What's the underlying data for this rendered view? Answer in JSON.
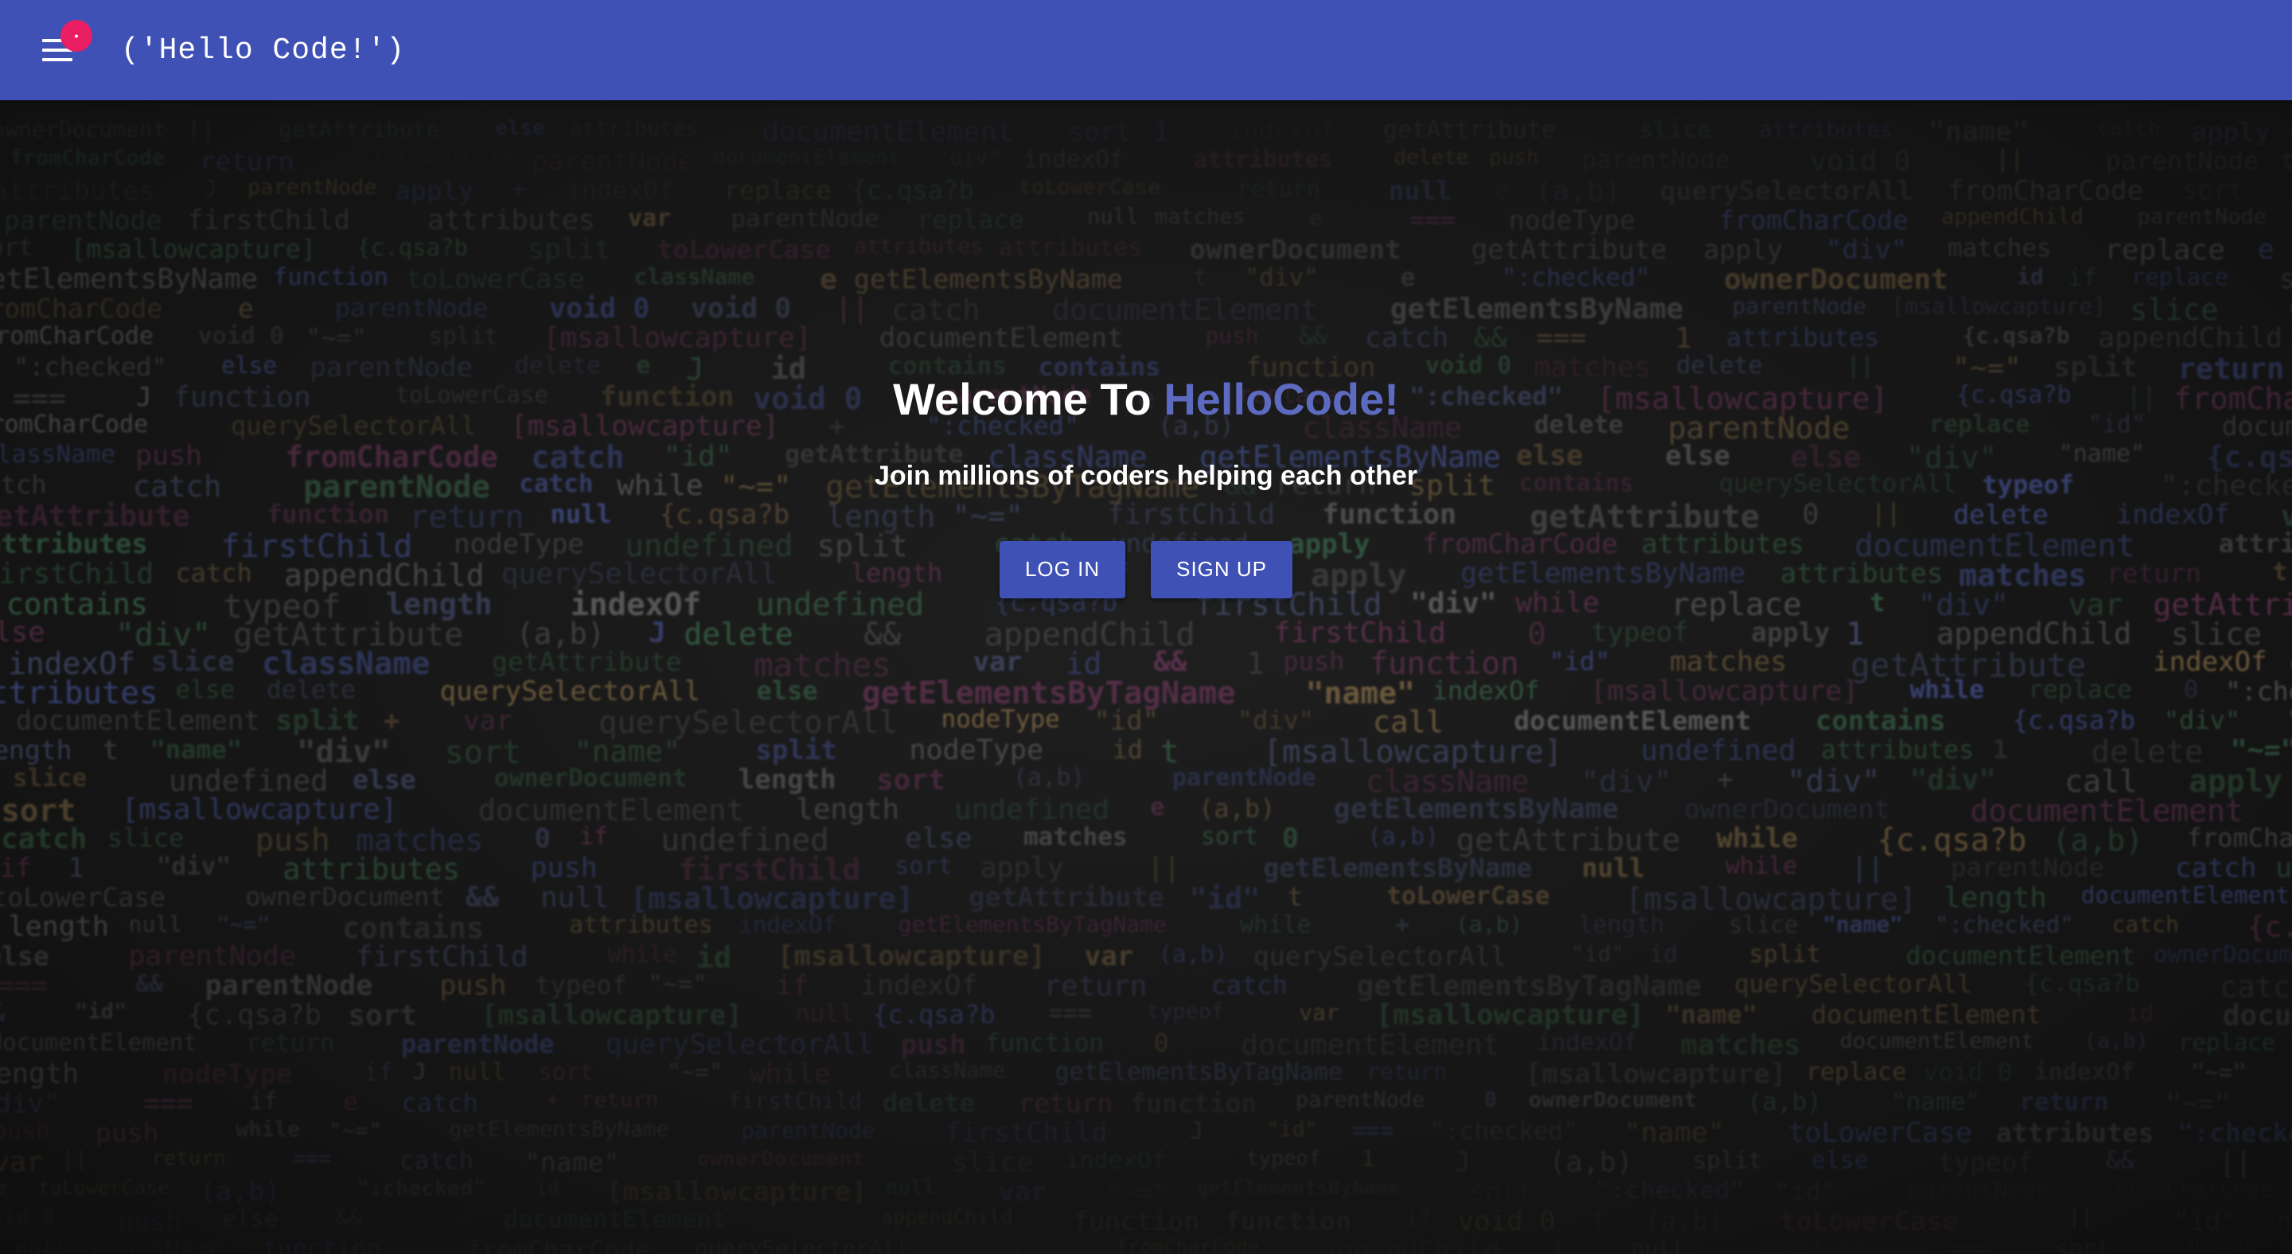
{
  "app": {
    "title": "('Hello Code!')",
    "notification_badge": "•"
  },
  "hero": {
    "welcome_prefix": "Welcome To ",
    "brand_name": "HelloCode!",
    "tagline": "Join millions of coders helping each other"
  },
  "actions": {
    "login_label": "LOG IN",
    "signup_label": "SIGN UP"
  },
  "icons": {
    "menu": "menu-icon"
  },
  "colors": {
    "primary": "#3f51b5",
    "brand_text": "#5c6bc0",
    "badge": "#e91e63",
    "background": "#141414"
  }
}
